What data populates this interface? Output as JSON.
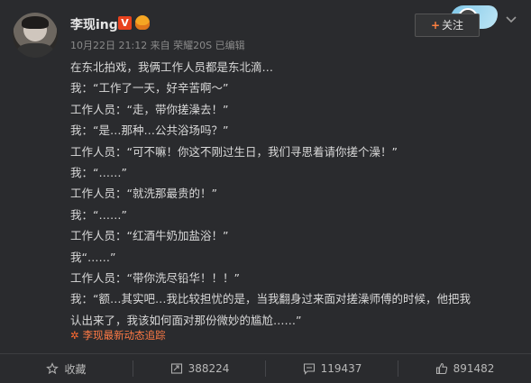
{
  "post": {
    "author": "李现ing",
    "verified_badge": "V",
    "meta": "10月22日 21:12 来自 荣耀20S  已编辑",
    "follow_label": "关注",
    "lines": [
      "在东北拍戏，我俩工作人员都是东北滴…",
      "我：“工作了一天，好辛苦啊～”",
      "工作人员：“走，带你搓澡去！”",
      "我：“是…那种…公共浴场吗？”",
      "工作人员：“可不嘛！你这不刚过生日，我们寻思着请你搓个澡！”",
      "我：“……”",
      "工作人员：“就洗那最贵的！”",
      "我：“……”",
      "工作人员：“红酒牛奶加盐浴！”",
      "我“……”",
      "工作人员：“带你洗尽铅华！！！”",
      "我：“额…其实吧…我比较担忧的是，当我翻身过来面对搓澡师傅的时候，他把我",
      "认出来了，我该如何面对那份微妙的尴尬……”"
    ],
    "origin_tag": "李现最新动态追踪"
  },
  "actions": {
    "favorite": "收藏",
    "repost": "388224",
    "comment": "119437",
    "like": "891482"
  },
  "colors": {
    "background": "#2a2b2e",
    "accent": "#ff7a45",
    "verified": "#e8421e"
  },
  "icons": [
    "star-icon",
    "repost-icon",
    "comment-icon",
    "like-icon",
    "chevron-down-icon",
    "plus-icon",
    "crown-icon"
  ]
}
